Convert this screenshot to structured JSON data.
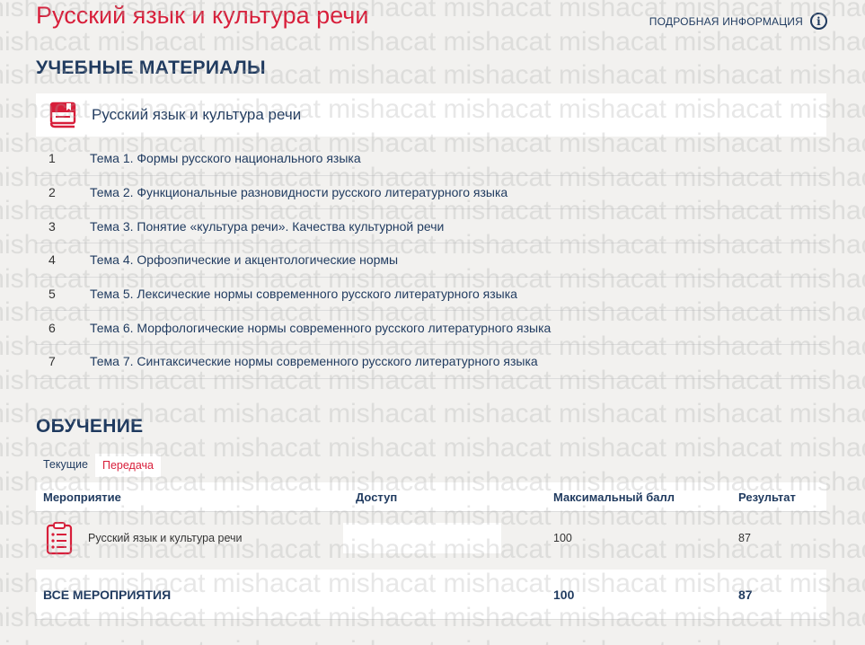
{
  "header": {
    "title": "Русский язык и культура речи",
    "more_info": "ПОДРОБНАЯ ИНФОРМАЦИЯ",
    "info_glyph": "i"
  },
  "materials": {
    "section_title": "УЧЕБНЫЕ МАТЕРИАЛЫ",
    "card_title": "Русский язык и культура речи",
    "topics": [
      {
        "num": "1",
        "title": "Тема 1. Формы русского национального языка"
      },
      {
        "num": "2",
        "title": "Тема 2. Функциональные разновидности русского литературного языка"
      },
      {
        "num": "3",
        "title": "Тема 3. Понятие «культура речи». Качества культурной речи"
      },
      {
        "num": "4",
        "title": "Тема 4. Орфоэпические и акцентологические нормы"
      },
      {
        "num": "5",
        "title": "Тема 5. Лексические нормы современного русского литературного языка"
      },
      {
        "num": "6",
        "title": "Тема 6. Морфологические нормы современного русского литературного языка"
      },
      {
        "num": "7",
        "title": "Тема 7. Синтаксические нормы современного русского литературного языка"
      }
    ]
  },
  "learning": {
    "section_title": "ОБУЧЕНИЕ",
    "tabs": {
      "current": "Текущие",
      "retake": "Передача"
    },
    "columns": {
      "event": "Мероприятие",
      "access": "Доступ",
      "max": "Максимальный балл",
      "result": "Результат"
    },
    "rows": [
      {
        "event": "Русский язык и культура речи",
        "max": "100",
        "result": "87"
      }
    ],
    "total": {
      "label": "ВСЕ МЕРОПРИЯТИЯ",
      "max": "100",
      "result": "87"
    }
  },
  "watermark": "mishacat",
  "colors": {
    "accent_red": "#d81e3a",
    "navy": "#1f3a5f",
    "background": "#f2f1ef"
  }
}
